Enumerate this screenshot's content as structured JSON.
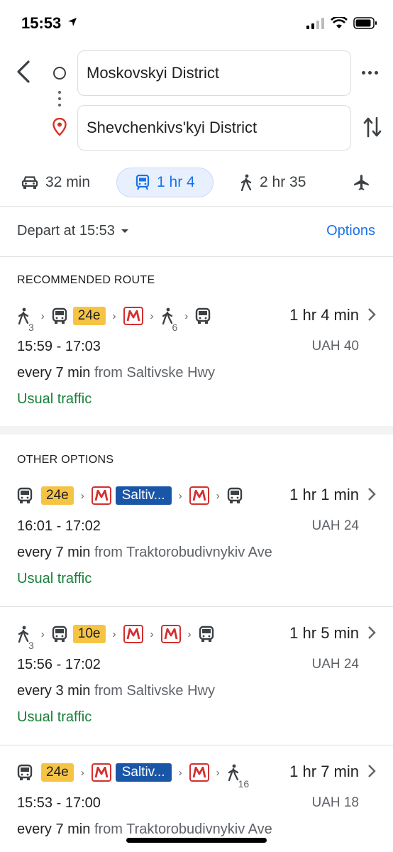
{
  "status": {
    "time": "15:53"
  },
  "search": {
    "origin": "Moskovskyi District",
    "destination": "Shevchenkivs'kyi District"
  },
  "modes": [
    {
      "name": "car",
      "label": "32 min"
    },
    {
      "name": "transit",
      "label": "1 hr 4"
    },
    {
      "name": "walk",
      "label": "2 hr 35"
    },
    {
      "name": "flight",
      "label": ""
    }
  ],
  "depart": {
    "label": "Depart at 15:53",
    "options": "Options"
  },
  "sections": {
    "recommended": "RECOMMENDED ROUTE",
    "other": "OTHER OPTIONS"
  },
  "routes": [
    {
      "duration": "1 hr 4 min",
      "times": "15:59 - 17:03",
      "fare": "UAH 40",
      "freq": "every 7 min",
      "from": "from Saltivske Hwy",
      "traffic": "Usual traffic",
      "walk1": "3",
      "bus_badge": "24e",
      "walk2": "6"
    },
    {
      "duration": "1 hr 1 min",
      "times": "16:01 - 17:02",
      "fare": "UAH 24",
      "freq": "every 7 min",
      "from": "from Traktorobudivnykiv Ave",
      "traffic": "Usual traffic",
      "bus_badge": "24e",
      "metro_badge": "Saltiv..."
    },
    {
      "duration": "1 hr 5 min",
      "times": "15:56 - 17:02",
      "fare": "UAH 24",
      "freq": "every 3 min",
      "from": "from Saltivske Hwy",
      "traffic": "Usual traffic",
      "walk1": "3",
      "bus_badge": "10e"
    },
    {
      "duration": "1 hr 7 min",
      "times": "15:53 - 17:00",
      "fare": "UAH 18",
      "freq": "every 7 min",
      "from": "from Traktorobudivnykiv Ave",
      "bus_badge": "24e",
      "metro_badge": "Saltiv...",
      "walk2": "16"
    }
  ],
  "colors": {
    "accent": "#1a73e8",
    "traffic": "#188038",
    "bus_badge": "#f6c445",
    "metro_badge": "#1a56a7",
    "metro_red": "#d32f2f"
  }
}
